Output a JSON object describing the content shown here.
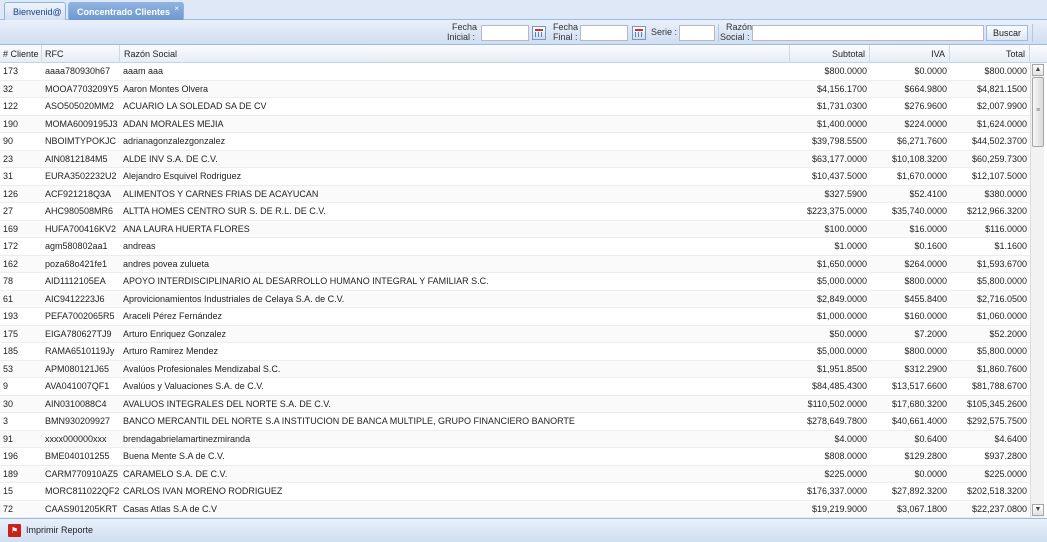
{
  "tabs": [
    {
      "label": "Bienvenid@"
    },
    {
      "label": "Concentrado Clientes",
      "close": "×"
    }
  ],
  "filters": {
    "fecha_inicial_label1": "Fecha",
    "fecha_inicial_label2": "Inicial :",
    "fecha_inicial_value": "",
    "fecha_final_label1": "Fecha",
    "fecha_final_label2": "Final :",
    "fecha_final_value": "",
    "serie_label": "Serie :",
    "serie_value": "",
    "razon_label1": "Razón",
    "razon_label2": "Social :",
    "razon_value": "",
    "buscar_label": "Buscar"
  },
  "columns": [
    "# Cliente",
    "RFC",
    "Razón Social",
    "Subtotal",
    "IVA",
    "Total"
  ],
  "rows": [
    [
      "173",
      "aaaa780930h67",
      "aaam aaa",
      "$800.0000",
      "$0.0000",
      "$800.0000"
    ],
    [
      "32",
      "MOOA7703209Y5",
      "Aaron Montes Olvera",
      "$4,156.1700",
      "$664.9800",
      "$4,821.1500"
    ],
    [
      "122",
      "ASO505020MM2",
      "ACUARIO LA SOLEDAD SA DE CV",
      "$1,731.0300",
      "$276.9600",
      "$2,007.9900"
    ],
    [
      "190",
      "MOMA6009195J3",
      "ADAN MORALES MEJIA",
      "$1,400.0000",
      "$224.0000",
      "$1,624.0000"
    ],
    [
      "90",
      "NBOIMTYPOKJC",
      "adrianagonzalezgonzalez",
      "$39,798.5500",
      "$6,271.7600",
      "$44,502.3700"
    ],
    [
      "23",
      "AIN0812184M5",
      "ALDE INV S.A. DE C.V.",
      "$63,177.0000",
      "$10,108.3200",
      "$60,259.7300"
    ],
    [
      "31",
      "EURA3502232U2",
      "Alejandro Esquivel Rodriguez",
      "$10,437.5000",
      "$1,670.0000",
      "$12,107.5000"
    ],
    [
      "126",
      "ACF921218Q3A",
      "ALIMENTOS Y CARNES FRIAS DE ACAYUCAN",
      "$327.5900",
      "$52.4100",
      "$380.0000"
    ],
    [
      "27",
      "AHC980508MR6",
      "ALTTA HOMES CENTRO SUR S. DE R.L. DE C.V.",
      "$223,375.0000",
      "$35,740.0000",
      "$212,966.3200"
    ],
    [
      "169",
      "HUFA700416KV2",
      "ANA LAURA HUERTA FLORES",
      "$100.0000",
      "$16.0000",
      "$116.0000"
    ],
    [
      "172",
      "agm580802aa1",
      "andreas",
      "$1.0000",
      "$0.1600",
      "$1.1600"
    ],
    [
      "162",
      "poza68o421fe1",
      "andres povea zulueta",
      "$1,650.0000",
      "$264.0000",
      "$1,593.6700"
    ],
    [
      "78",
      "AID1112105EA",
      "APOYO INTERDISCIPLINARIO AL DESARROLLO HUMANO INTEGRAL Y FAMILIAR S.C.",
      "$5,000.0000",
      "$800.0000",
      "$5,800.0000"
    ],
    [
      "61",
      "AIC9412223J6",
      "Aprovicionamientos Industriales de Celaya S.A. de C.V.",
      "$2,849.0000",
      "$455.8400",
      "$2,716.0500"
    ],
    [
      "193",
      "PEFA7002065R5",
      "Araceli Pérez Fernández",
      "$1,000.0000",
      "$160.0000",
      "$1,060.0000"
    ],
    [
      "175",
      "EIGA780627TJ9",
      "Arturo Enriquez Gonzalez",
      "$50.0000",
      "$7.2000",
      "$52.2000"
    ],
    [
      "185",
      "RAMA6510119Jy",
      "Arturo Ramirez Mendez",
      "$5,000.0000",
      "$800.0000",
      "$5,800.0000"
    ],
    [
      "53",
      "APM080121J65",
      "Avalúos Profesionales Mendizabal S.C.",
      "$1,951.8500",
      "$312.2900",
      "$1,860.7600"
    ],
    [
      "9",
      "AVA041007QF1",
      "Avalúos y Valuaciones S.A. de C.V.",
      "$84,485.4300",
      "$13,517.6600",
      "$81,788.6700"
    ],
    [
      "30",
      "AIN0310088C4",
      "AVALUOS INTEGRALES DEL NORTE S.A. DE C.V.",
      "$110,502.0000",
      "$17,680.3200",
      "$105,345.2600"
    ],
    [
      "3",
      "BMN930209927",
      "BANCO MERCANTIL DEL NORTE S.A INSTITUCION DE BANCA MULTIPLE, GRUPO FINANCIERO BANORTE",
      "$278,649.7800",
      "$40,661.4000",
      "$292,575.7500"
    ],
    [
      "91",
      "xxxx000000xxx",
      "brendagabrielamartinezmiranda",
      "$4.0000",
      "$0.6400",
      "$4.6400"
    ],
    [
      "196",
      "BME040101255",
      "Buena Mente S.A de C.V.",
      "$808.0000",
      "$129.2800",
      "$937.2800"
    ],
    [
      "189",
      "CARM770910AZ5",
      "CARAMELO S.A. DE C.V.",
      "$225.0000",
      "$0.0000",
      "$225.0000"
    ],
    [
      "15",
      "MORC811022QF2",
      "CARLOS IVAN MORENO RODRIGUEZ",
      "$176,337.0000",
      "$27,892.3200",
      "$202,518.3200"
    ],
    [
      "72",
      "CAAS901205KRT",
      "Casas Atlas S.A de C.V",
      "$19,219.9000",
      "$3,067.1800",
      "$22,237.0800"
    ]
  ],
  "footer": {
    "print_label": "Imprimir Reporte"
  },
  "icons": {
    "pdf": "pdf-icon",
    "calendar": "calendar-icon",
    "close": "close-icon"
  }
}
